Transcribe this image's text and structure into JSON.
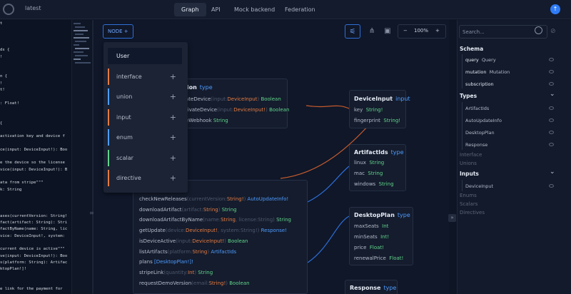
{
  "header": {
    "project": "latest",
    "tabs": [
      "Graph",
      "API",
      "Mock backend",
      "Federation"
    ],
    "active_tab": "Graph"
  },
  "editor": {
    "lines": [
      "t",
      "",
      "",
      "",
      "ds {",
      "!",
      "",
      "",
      "n {",
      "!",
      "t!",
      "",
      ": Float!",
      "",
      "",
      "{",
      "",
      "activation key and device f",
      "",
      "ce(input: DeviceInput!): Boo",
      "",
      "e the device so the license",
      "vice(input: DeviceInput!): B",
      "",
      "ata from stripe\"\"\"",
      "k: String",
      "",
      "",
      "",
      "ases(currentVersion: String!",
      "fact(artifact: String): Stri",
      "factByName(name: String, lic",
      "vice: DeviceInput!, system:",
      "",
      "current device is active\"\"\"",
      "ve(input: DeviceInput!): Boo",
      "s(platform: String): Artifac",
      "ktopPlan!]!",
      "",
      "",
      "e link for the payment for"
    ]
  },
  "toolbar": {
    "node_label": "NODE",
    "zoom": "100%",
    "zoom_minus": "−",
    "zoom_plus": "+"
  },
  "node_menu": {
    "items": [
      {
        "label": "User"
      },
      {
        "label": "interface",
        "color": "#e57b42"
      },
      {
        "label": "union",
        "color": "#4f9cff"
      },
      {
        "label": "input",
        "color": "#e57b42"
      },
      {
        "label": "enum",
        "color": "#4f9cff"
      },
      {
        "label": "scalar",
        "color": "#62d48a"
      },
      {
        "label": "directive",
        "color": "#e57b42"
      }
    ]
  },
  "nodes": {
    "mutation": {
      "title_kind": "type",
      "title_partial": "tion",
      "fields": [
        {
          "name": "ateDevice",
          "args": "(input:",
          "argtype": "DeviceInput",
          "close": ")",
          "type": "Boolean"
        },
        {
          "name": "tivateDevice",
          "args": "(input:",
          "argtype": "DeviceInput!",
          "close": ")",
          "type": "Boolean"
        },
        {
          "name": "eWebhook",
          "args": "",
          "argtype": "",
          "close": "",
          "type": "String"
        }
      ]
    },
    "query": {
      "fields": [
        {
          "name": "checkNewReleases",
          "args": "(currentVersion:",
          "argtype": "String!",
          "close": ")",
          "type": "AutoUpdateInfo!"
        },
        {
          "name": "downloadArtifact",
          "args": "(artifact:",
          "argtype": "String",
          "close": ")",
          "type": "String"
        },
        {
          "name": "downloadArtifactByName",
          "args": "(name:",
          "argtype": "String",
          "close": ", license:String)",
          "type": "String"
        },
        {
          "name": "getUpdate",
          "args": "(device:",
          "argtype": "DeviceInput!",
          "close": ", system:String!)",
          "type": "Response!"
        },
        {
          "name": "isDeviceActive",
          "args": "(input:",
          "argtype": "DeviceInput!",
          "close": ")",
          "type": "Boolean"
        },
        {
          "name": "listArtifacts",
          "args": "(platform:",
          "argtype": "String",
          "close": ")",
          "type": "ArtifactIds"
        },
        {
          "name": "plans",
          "args": "",
          "argtype": "",
          "close": "",
          "type": "[DesktopPlan!]!"
        },
        {
          "name": "stripeLink",
          "args": "(quantity:",
          "argtype": "Int",
          "close": ")",
          "type": "String"
        },
        {
          "name": "requestDemoVersion",
          "args": "(email:",
          "argtype": "String!",
          "close": ")",
          "type": "Boolean"
        }
      ]
    },
    "deviceInput": {
      "title": "DeviceInput",
      "kind": "input",
      "fields": [
        {
          "name": "key",
          "type": "String!"
        },
        {
          "name": "fingerprint",
          "type": "String!"
        }
      ]
    },
    "artifactIds": {
      "title": "ArtifactIds",
      "kind": "type",
      "fields": [
        {
          "name": "linux",
          "type": "String"
        },
        {
          "name": "mac",
          "type": "String"
        },
        {
          "name": "windows",
          "type": "String"
        }
      ]
    },
    "desktopPlan": {
      "title": "DesktopPlan",
      "kind": "type",
      "fields": [
        {
          "name": "maxSeats",
          "type": "Int"
        },
        {
          "name": "minSeats",
          "type": "Int!"
        },
        {
          "name": "price",
          "type": "Float!"
        },
        {
          "name": "renewalPrice",
          "type": "Float!"
        }
      ]
    },
    "response": {
      "title": "Response",
      "kind": "type"
    }
  },
  "sidebar": {
    "search_placeholder": "Search...",
    "schema_title": "Schema",
    "schema_items": [
      {
        "name": "query",
        "type": "Query"
      },
      {
        "name": "mutation",
        "type": "Mutation"
      },
      {
        "name": "subscription",
        "type": ""
      }
    ],
    "types_title": "Types",
    "types_items": [
      "ArtifactIds",
      "AutoUpdateInfo",
      "DesktopPlan",
      "Response"
    ],
    "disabled_after_types": [
      "Interface",
      "Unions"
    ],
    "inputs_title": "Inputs",
    "inputs_items": [
      "DeviceInput"
    ],
    "disabled_after_inputs": [
      "Enums",
      "Scalars",
      "Directives"
    ]
  },
  "colors": {
    "accent": "#2f7cf6",
    "type_green": "#62d48a",
    "type_orange": "#e57b42",
    "type_blue": "#4f9cff"
  }
}
